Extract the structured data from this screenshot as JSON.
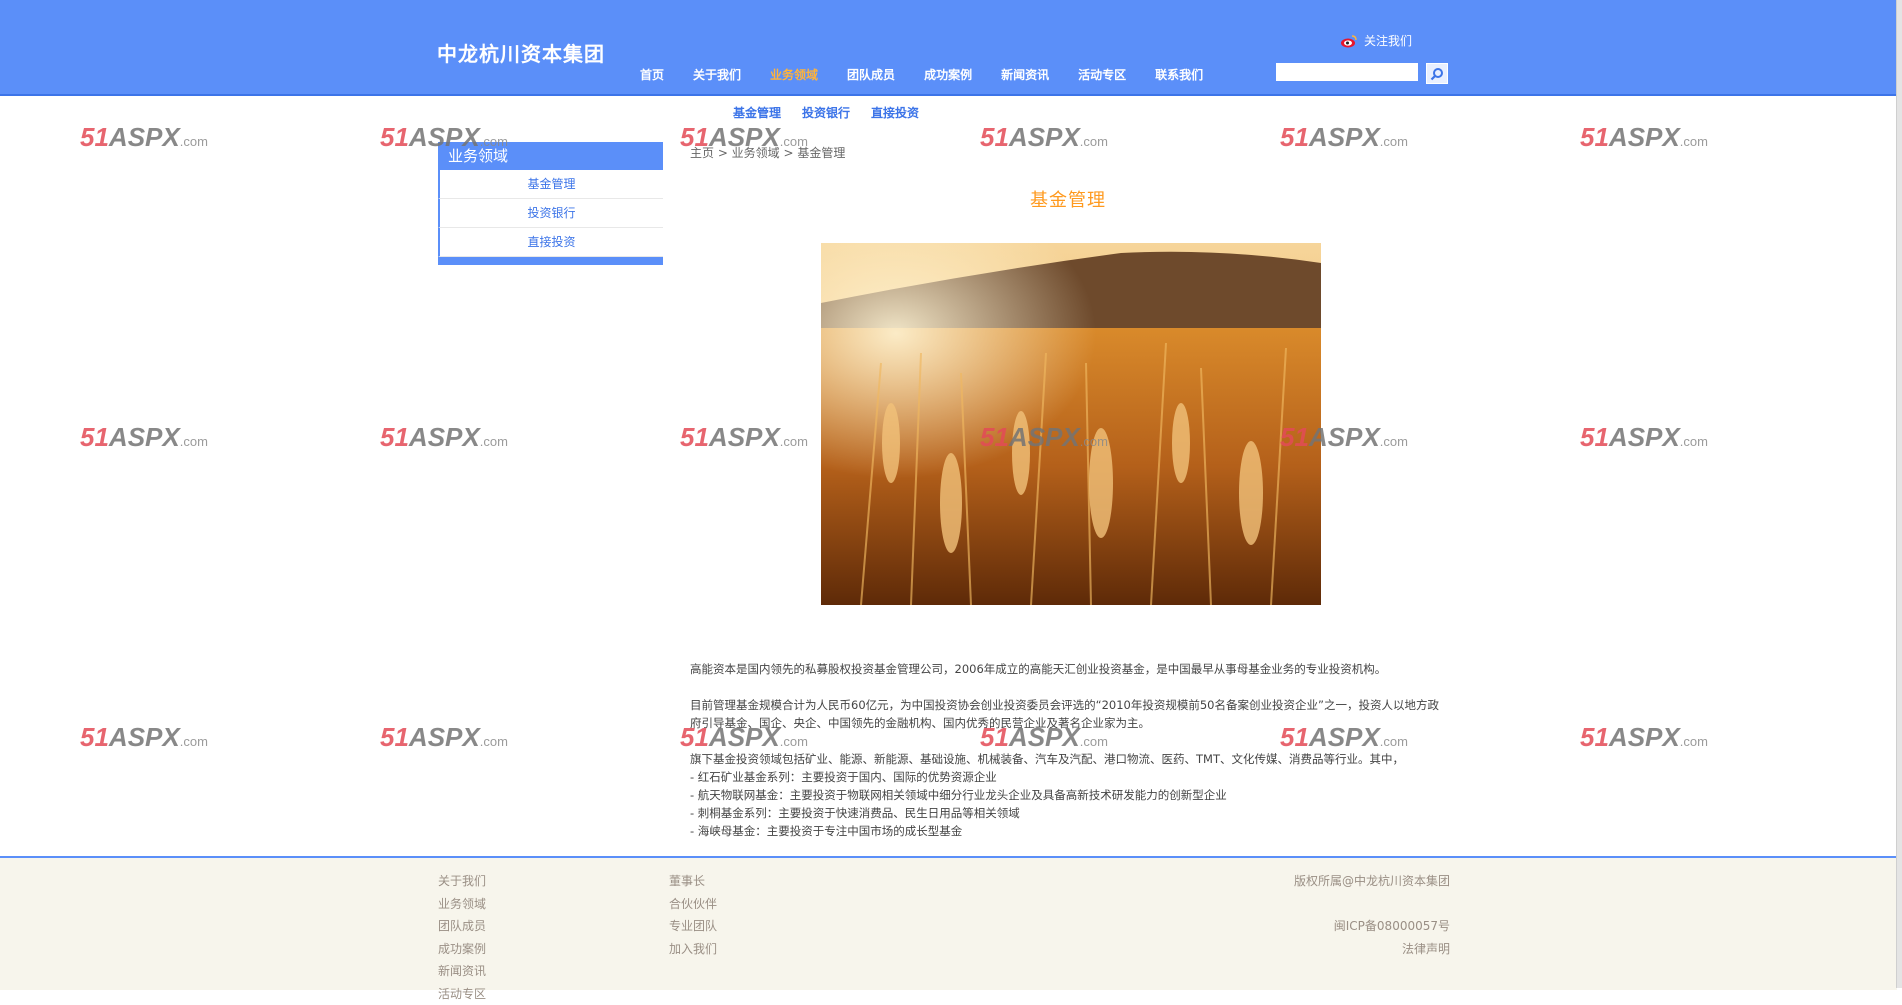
{
  "header": {
    "site_title": "中龙杭川资本集团",
    "follow_label": "关注我们",
    "search_placeholder": "",
    "colors": {
      "primary": "#5b8ff9",
      "active_nav": "#ffb33b",
      "footer_bg": "#f7f5ec",
      "title_orange": "#ff9a1f"
    }
  },
  "nav": {
    "items": [
      {
        "label": "首页"
      },
      {
        "label": "关于我们"
      },
      {
        "label": "业务领域"
      },
      {
        "label": "团队成员"
      },
      {
        "label": "成功案例"
      },
      {
        "label": "新闻资讯"
      },
      {
        "label": "活动专区"
      },
      {
        "label": "联系我们"
      }
    ],
    "active": "业务领域"
  },
  "subnav": {
    "items": [
      {
        "label": "基金管理"
      },
      {
        "label": "投资银行"
      },
      {
        "label": "直接投资"
      }
    ]
  },
  "sidebar": {
    "title": "业务领域",
    "items": [
      {
        "label": "基金管理"
      },
      {
        "label": "投资银行"
      },
      {
        "label": "直接投资"
      }
    ]
  },
  "breadcrumb": {
    "text": "主页 > 业务领域 > 基金管理"
  },
  "main": {
    "title": "基金管理",
    "paragraphs": [
      "高能资本是国内领先的私募股权投资基金管理公司，2006年成立的高能天汇创业投资基金，是中国最早从事母基金业务的专业投资机构。",
      "目前管理基金规模合计为人民币60亿元，为中国投资协会创业投资委员会评选的“2010年投资规模前50名备案创业投资企业”之一，投资人以地方政府引导基金、国企、央企、中国领先的金融机构、国内优秀的民营企业及著名企业家为主。"
    ],
    "list_intro": "旗下基金投资领域包括矿业、能源、新能源、基础设施、机械装备、汽车及汽配、港口物流、医药、TMT、文化传媒、消费品等行业。其中，",
    "list_items": [
      "-   红石矿业基金系列：主要投资于国内、国际的优势资源企业",
      "-   航天物联网基金：主要投资于物联网相关领域中细分行业龙头企业及具备高新技术研发能力的创新型企业",
      "-   刺桐基金系列：主要投资于快速消费品、民生日用品等相关领域",
      "-   海峡母基金：主要投资于专注中国市场的成长型基金"
    ]
  },
  "footer": {
    "col1": [
      {
        "label": "关于我们"
      },
      {
        "label": "业务领域"
      },
      {
        "label": "团队成员"
      },
      {
        "label": "成功案例"
      },
      {
        "label": "新闻资讯"
      },
      {
        "label": "活动专区"
      }
    ],
    "col2": [
      {
        "label": "董事长"
      },
      {
        "label": "合伙伙伴"
      },
      {
        "label": "专业团队"
      },
      {
        "label": "加入我们"
      }
    ],
    "copyright": "版权所属@中龙杭川资本集团",
    "icp": "闽ICP备08000057号",
    "legal": "法律声明"
  },
  "watermark": {
    "num": "51",
    "brand": "ASPX",
    "suffix": ".com"
  }
}
